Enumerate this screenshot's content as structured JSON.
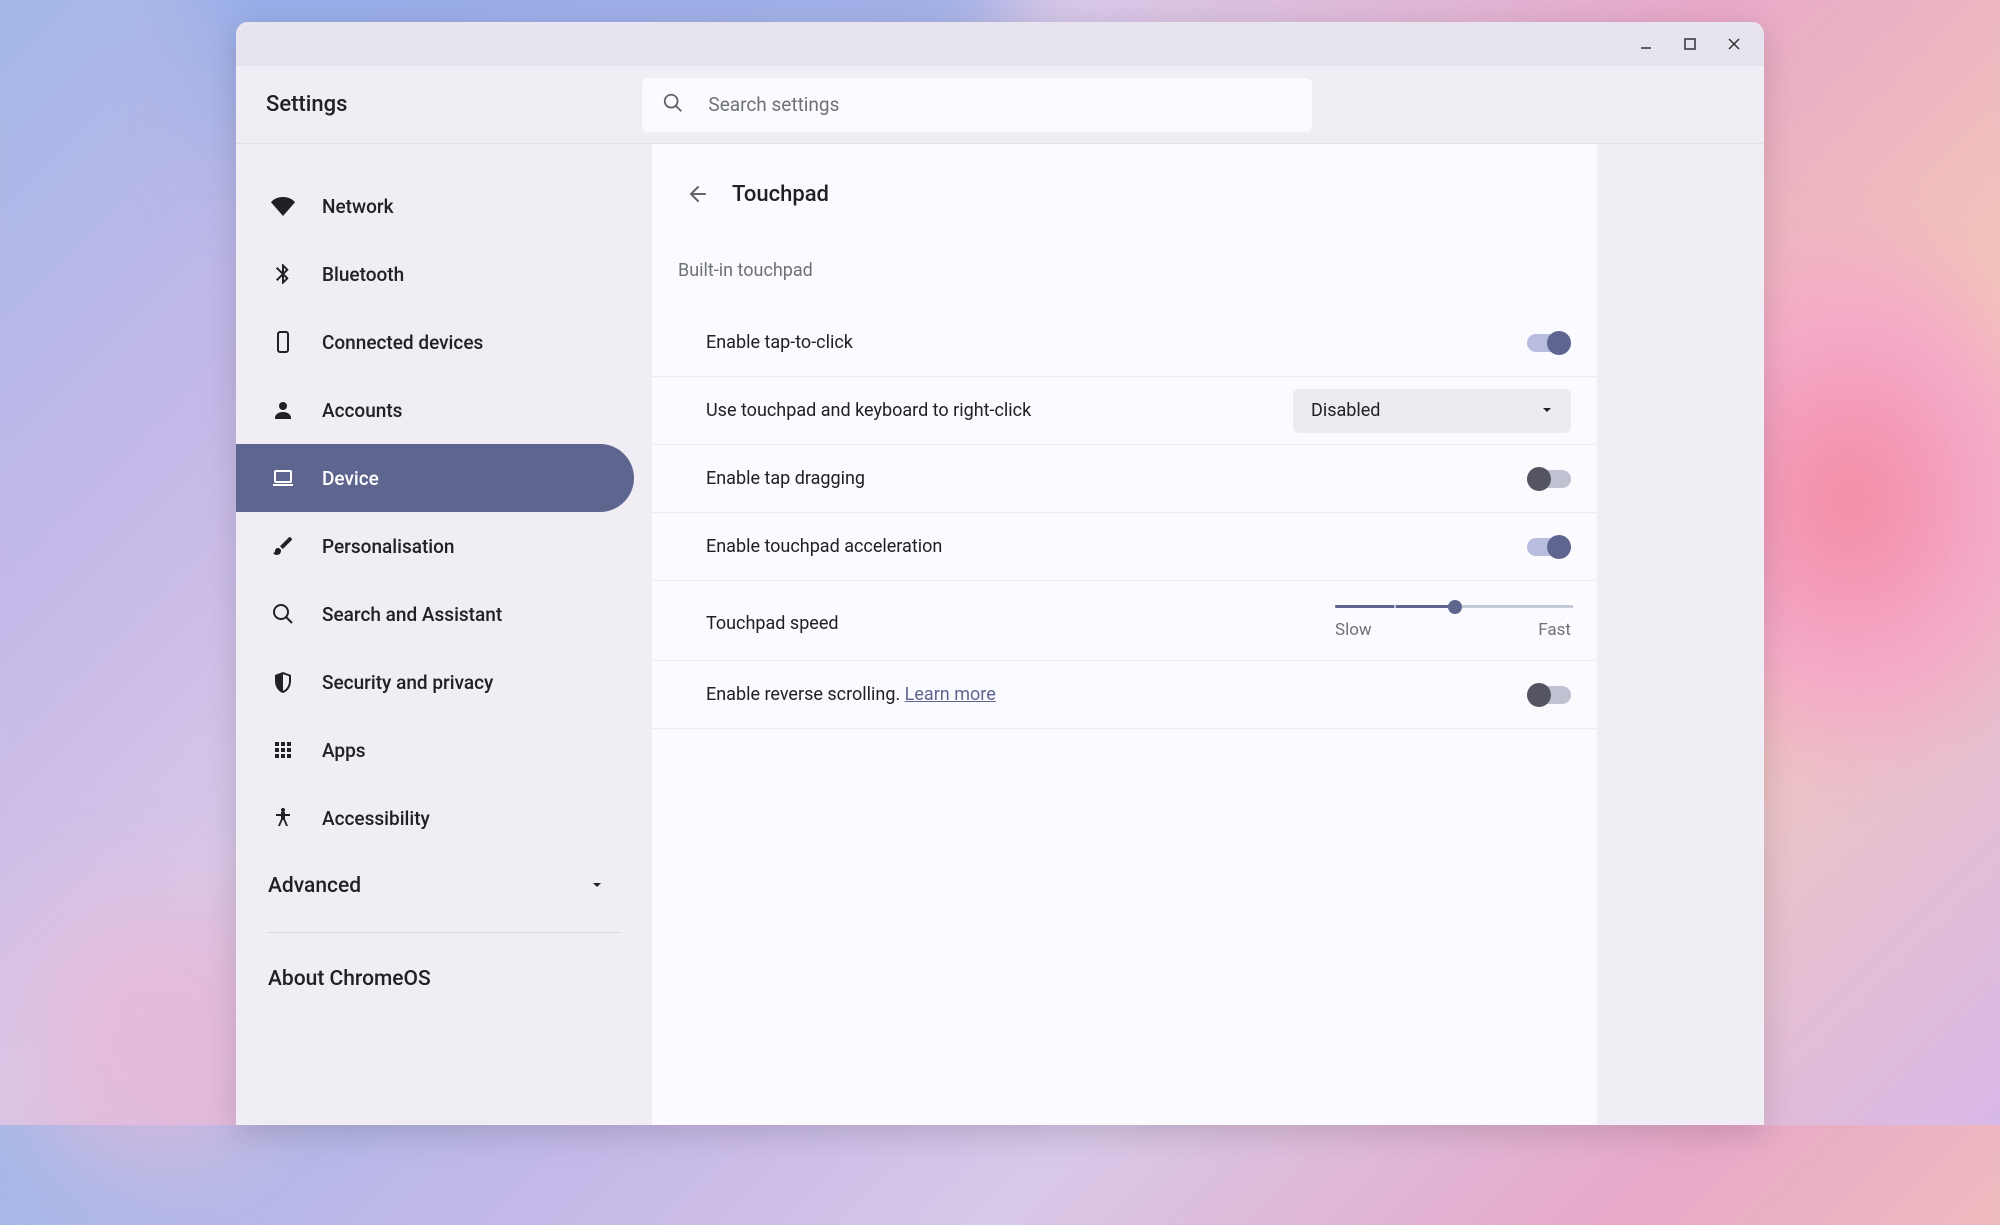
{
  "header": {
    "title": "Settings",
    "search_placeholder": "Search settings"
  },
  "sidebar": {
    "items": [
      {
        "id": "network",
        "label": "Network",
        "icon": "wifi"
      },
      {
        "id": "bluetooth",
        "label": "Bluetooth",
        "icon": "bluetooth"
      },
      {
        "id": "connected-devices",
        "label": "Connected devices",
        "icon": "device"
      },
      {
        "id": "accounts",
        "label": "Accounts",
        "icon": "person"
      },
      {
        "id": "device",
        "label": "Device",
        "icon": "laptop",
        "active": true
      },
      {
        "id": "personalisation",
        "label": "Personalisation",
        "icon": "brush"
      },
      {
        "id": "search-assistant",
        "label": "Search and Assistant",
        "icon": "search"
      },
      {
        "id": "security-privacy",
        "label": "Security and privacy",
        "icon": "shield"
      },
      {
        "id": "apps",
        "label": "Apps",
        "icon": "apps"
      },
      {
        "id": "accessibility",
        "label": "Accessibility",
        "icon": "accessibility"
      }
    ],
    "advanced_label": "Advanced",
    "about_label": "About ChromeOS"
  },
  "main": {
    "page_title": "Touchpad",
    "section_header": "Built-in touchpad",
    "settings": {
      "tap_to_click": {
        "label": "Enable tap-to-click",
        "value": true
      },
      "right_click": {
        "label": "Use touchpad and keyboard to right-click",
        "value": "Disabled"
      },
      "tap_dragging": {
        "label": "Enable tap dragging",
        "value": false
      },
      "acceleration": {
        "label": "Enable touchpad acceleration",
        "value": true
      },
      "speed": {
        "label": "Touchpad speed",
        "slow_label": "Slow",
        "fast_label": "Fast",
        "value": 50
      },
      "reverse_scrolling": {
        "label": "Enable reverse scrolling. ",
        "learn_more": "Learn more",
        "value": false
      }
    }
  }
}
